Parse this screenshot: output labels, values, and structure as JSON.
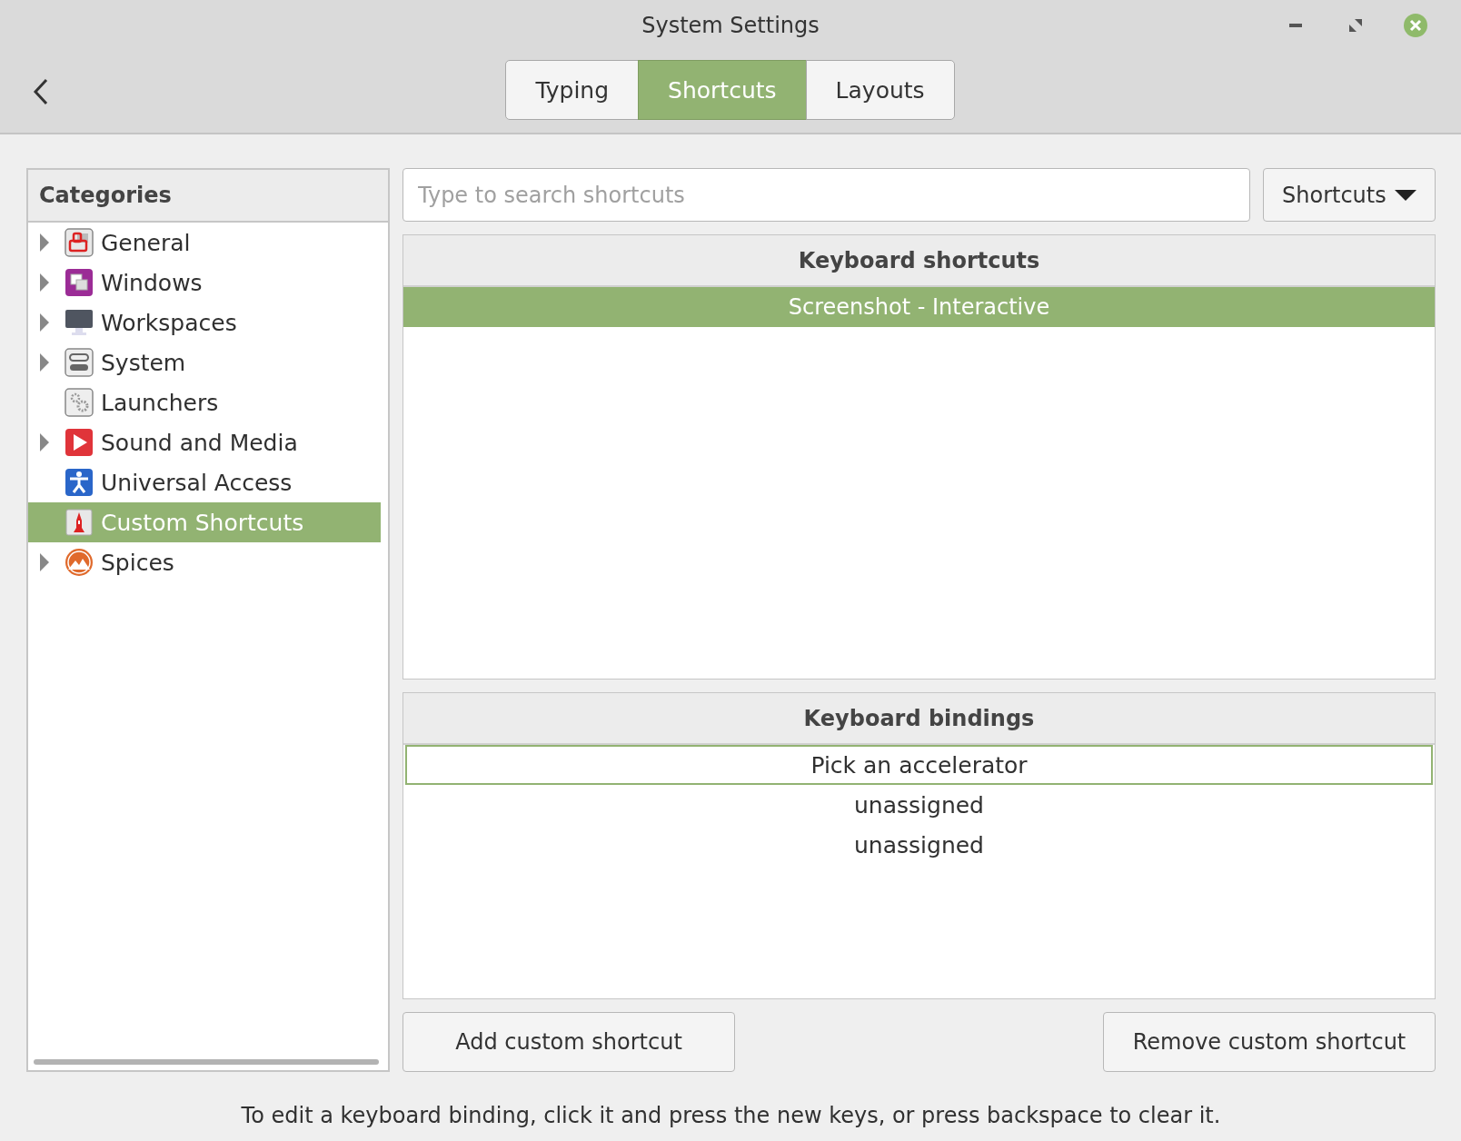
{
  "window": {
    "title": "System Settings"
  },
  "tabs": [
    {
      "label": "Typing",
      "selected": false
    },
    {
      "label": "Shortcuts",
      "selected": true
    },
    {
      "label": "Layouts",
      "selected": false
    }
  ],
  "categories": {
    "title": "Categories",
    "items": [
      {
        "label": "General",
        "kind": "general",
        "expandable": true,
        "selected": false
      },
      {
        "label": "Windows",
        "kind": "windows",
        "expandable": true,
        "selected": false
      },
      {
        "label": "Workspaces",
        "kind": "workspaces",
        "expandable": true,
        "selected": false
      },
      {
        "label": "System",
        "kind": "system",
        "expandable": true,
        "selected": false
      },
      {
        "label": "Launchers",
        "kind": "launchers",
        "expandable": false,
        "selected": false
      },
      {
        "label": "Sound and Media",
        "kind": "media",
        "expandable": true,
        "selected": false
      },
      {
        "label": "Universal Access",
        "kind": "access",
        "expandable": false,
        "selected": false
      },
      {
        "label": "Custom Shortcuts",
        "kind": "custom",
        "expandable": false,
        "selected": true
      },
      {
        "label": "Spices",
        "kind": "spices",
        "expandable": true,
        "selected": false
      }
    ]
  },
  "search": {
    "placeholder": "Type to search shortcuts"
  },
  "filter_dropdown": {
    "label": "Shortcuts"
  },
  "shortcuts_table": {
    "header": "Keyboard shortcuts",
    "rows": [
      {
        "label": "Screenshot - Interactive",
        "selected": true
      }
    ]
  },
  "bindings_table": {
    "header": "Keyboard bindings",
    "rows": [
      {
        "label": "Pick an accelerator",
        "editing": true
      },
      {
        "label": "unassigned",
        "editing": false
      },
      {
        "label": "unassigned",
        "editing": false
      }
    ]
  },
  "buttons": {
    "add": "Add custom shortcut",
    "remove": "Remove custom shortcut"
  },
  "hint": "To edit a keyboard binding, click it and press the new keys, or press backspace to clear it."
}
